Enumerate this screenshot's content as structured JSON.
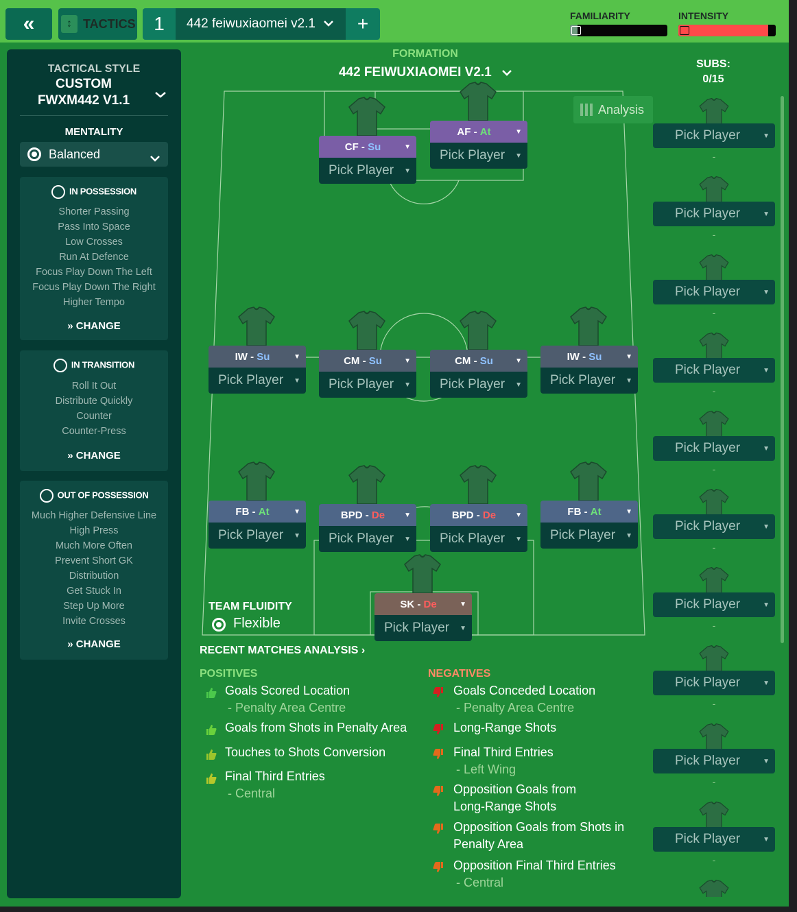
{
  "topbar": {
    "back_icon": "«",
    "tactics_label": "TACTICS",
    "tactic_slot": "1",
    "tactic_name": "442 feiwuxiaomei v2.1",
    "add_label": "+",
    "familiarity_label": "FAMILIARITY",
    "familiarity_level": 0.08,
    "intensity_label": "INTENSITY",
    "intensity_level": 0.92
  },
  "sidebar": {
    "style_label": "TACTICAL STYLE",
    "style_value_1": "CUSTOM",
    "style_value_2": "FWXM442 V1.1",
    "mentality_label": "MENTALITY",
    "mentality_value": "Balanced",
    "in_possession": {
      "title": "IN POSSESSION",
      "items": [
        "Shorter Passing",
        "Pass Into Space",
        "Low Crosses",
        "Run At Defence",
        "Focus Play Down The Left",
        "Focus Play Down The Right",
        "Higher Tempo"
      ],
      "change": "CHANGE"
    },
    "in_transition": {
      "title": "IN TRANSITION",
      "items": [
        "Roll It Out",
        "Distribute Quickly",
        "Counter",
        "Counter-Press"
      ],
      "change": "CHANGE"
    },
    "out_of_possession": {
      "title": "OUT OF POSSESSION",
      "items": [
        "Much Higher Defensive Line",
        "High Press",
        "Much More Often",
        "Prevent Short GK",
        "Distribution",
        "Get Stuck In",
        "Step Up More",
        "Invite Crosses"
      ],
      "change": "CHANGE"
    }
  },
  "formation": {
    "label": "FORMATION",
    "name": "442 FEIWUXIAOMEI V2.1",
    "analysis": "Analysis",
    "subs_label": "SUBS:",
    "subs_count": "0/15"
  },
  "players": [
    {
      "role": "CF",
      "duty": "Su",
      "pick": "Pick Player"
    },
    {
      "role": "AF",
      "duty": "At",
      "pick": "Pick Player"
    },
    {
      "role": "IW",
      "duty": "Su",
      "pick": "Pick Player"
    },
    {
      "role": "CM",
      "duty": "Su",
      "pick": "Pick Player"
    },
    {
      "role": "CM",
      "duty": "Su",
      "pick": "Pick Player"
    },
    {
      "role": "IW",
      "duty": "Su",
      "pick": "Pick Player"
    },
    {
      "role": "FB",
      "duty": "At",
      "pick": "Pick Player"
    },
    {
      "role": "BPD",
      "duty": "De",
      "pick": "Pick Player"
    },
    {
      "role": "BPD",
      "duty": "De",
      "pick": "Pick Player"
    },
    {
      "role": "FB",
      "duty": "At",
      "pick": "Pick Player"
    },
    {
      "role": "SK",
      "duty": "De",
      "pick": "Pick Player"
    }
  ],
  "subs": {
    "pick": "Pick Player",
    "dash": "-"
  },
  "team_fluidity": {
    "label": "TEAM FLUIDITY",
    "value": "Flexible"
  },
  "recent": {
    "title": "RECENT MATCHES ANALYSIS",
    "positives_label": "POSITIVES",
    "negatives_label": "NEGATIVES",
    "positives": [
      {
        "text": "Goals Scored Location",
        "detail": "- Penalty Area Centre"
      },
      {
        "text": "Goals from Shots in Penalty Area",
        "detail": ""
      },
      {
        "text": "Touches to Shots Conversion",
        "detail": ""
      },
      {
        "text": "Final Third Entries",
        "detail": "- Central"
      }
    ],
    "negatives": [
      {
        "text": "Goals Conceded Location",
        "detail": "- Penalty Area Centre"
      },
      {
        "text": "Long-Range Shots",
        "detail": ""
      },
      {
        "text": "Final Third Entries",
        "detail": "- Left Wing"
      },
      {
        "text": "Opposition Goals from",
        "detail": "Long-Range Shots"
      },
      {
        "text": "Opposition Goals from Shots in",
        "detail": "Penalty Area"
      },
      {
        "text": "Opposition Final Third Entries",
        "detail": "- Central"
      }
    ]
  },
  "colors": {
    "pitch": "#1e8c38",
    "topbar": "#56c24a",
    "sidebar": "#053a33",
    "positive": "#8be07f",
    "negative": "#ff8a66"
  }
}
